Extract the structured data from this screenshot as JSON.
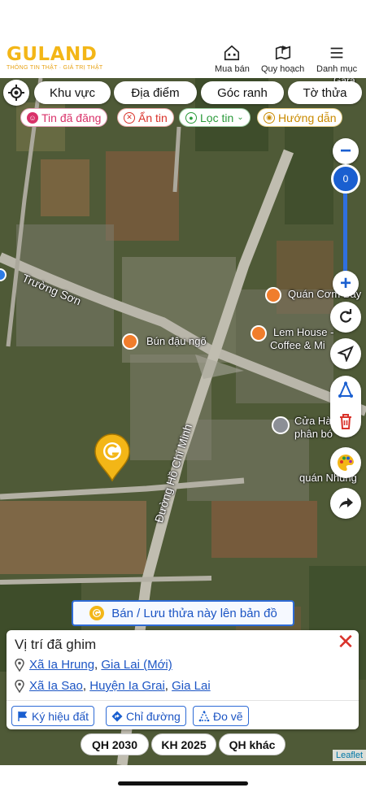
{
  "header": {
    "logo_text": "GULAND",
    "logo_tagline": "THÔNG TIN THẬT · GIÁ TRỊ THẬT",
    "nav": [
      {
        "label": "Mua bán",
        "icon": "house-icon"
      },
      {
        "label": "Quy hoạch",
        "icon": "map-flag-icon"
      },
      {
        "label": "Danh mục",
        "icon": "menu-icon"
      }
    ]
  },
  "filters": {
    "pills": [
      "Khu vực",
      "Địa điểm",
      "Góc ranh",
      "Tờ thửa"
    ],
    "tags": [
      {
        "label": "Tin đã đăng",
        "icon": "smile-icon",
        "color": "#d9326a"
      },
      {
        "label": "Ẩn tin",
        "icon": "close-circle-icon",
        "color": "#d9322a"
      },
      {
        "label": "Lọc tin",
        "icon": "pin-icon",
        "color": "#2a9a3a"
      },
      {
        "label": "Hướng dẫn",
        "icon": "target-icon",
        "color": "#c98a00"
      }
    ]
  },
  "zoom": {
    "minus": "−",
    "plus": "+",
    "level": "0"
  },
  "map_labels": {
    "street_truong_son": "Trường Sơn",
    "street_ho_chi_minh": "Đường Hồ Chí Minh",
    "poi_bun_dau": "Bún đậu ngõ",
    "poi_quan_com": "Quán Cơm Bảy",
    "poi_lem_house_1": "Lem House -",
    "poi_lem_house_2": "Coffee & Mi",
    "poi_cua_hang_1": "Cửa Hà",
    "poi_cua_hang_2": "phân bó",
    "poi_quan_nhung": "quán Nhung",
    "poi_gara": "Gara"
  },
  "sell_banner": {
    "label": "Bán / Lưu thửa này lên bản đồ"
  },
  "card": {
    "title": "Vị trí đã ghim",
    "close": "✕",
    "address1": {
      "part1": "Xã Ia Hrung",
      "sep": ", ",
      "part2": "Gia Lai (Mới)"
    },
    "address2": {
      "part1": "Xã Ia Sao",
      "sep1": ", ",
      "part2": "Huyện Ia Grai",
      "sep2": ", ",
      "part3": "Gia Lai"
    },
    "buttons": [
      {
        "label": "Ký hiệu đất",
        "icon": "flag-icon"
      },
      {
        "label": "Chỉ đường",
        "icon": "directions-icon"
      },
      {
        "label": "Đo vẽ",
        "icon": "measure-icon"
      }
    ]
  },
  "qh": [
    "QH 2030",
    "KH 2025",
    "QH khác"
  ],
  "attribution": "Leaflet",
  "colors": {
    "brand": "#f3b617",
    "accent": "#1a5fd0",
    "danger": "#d9322a"
  }
}
